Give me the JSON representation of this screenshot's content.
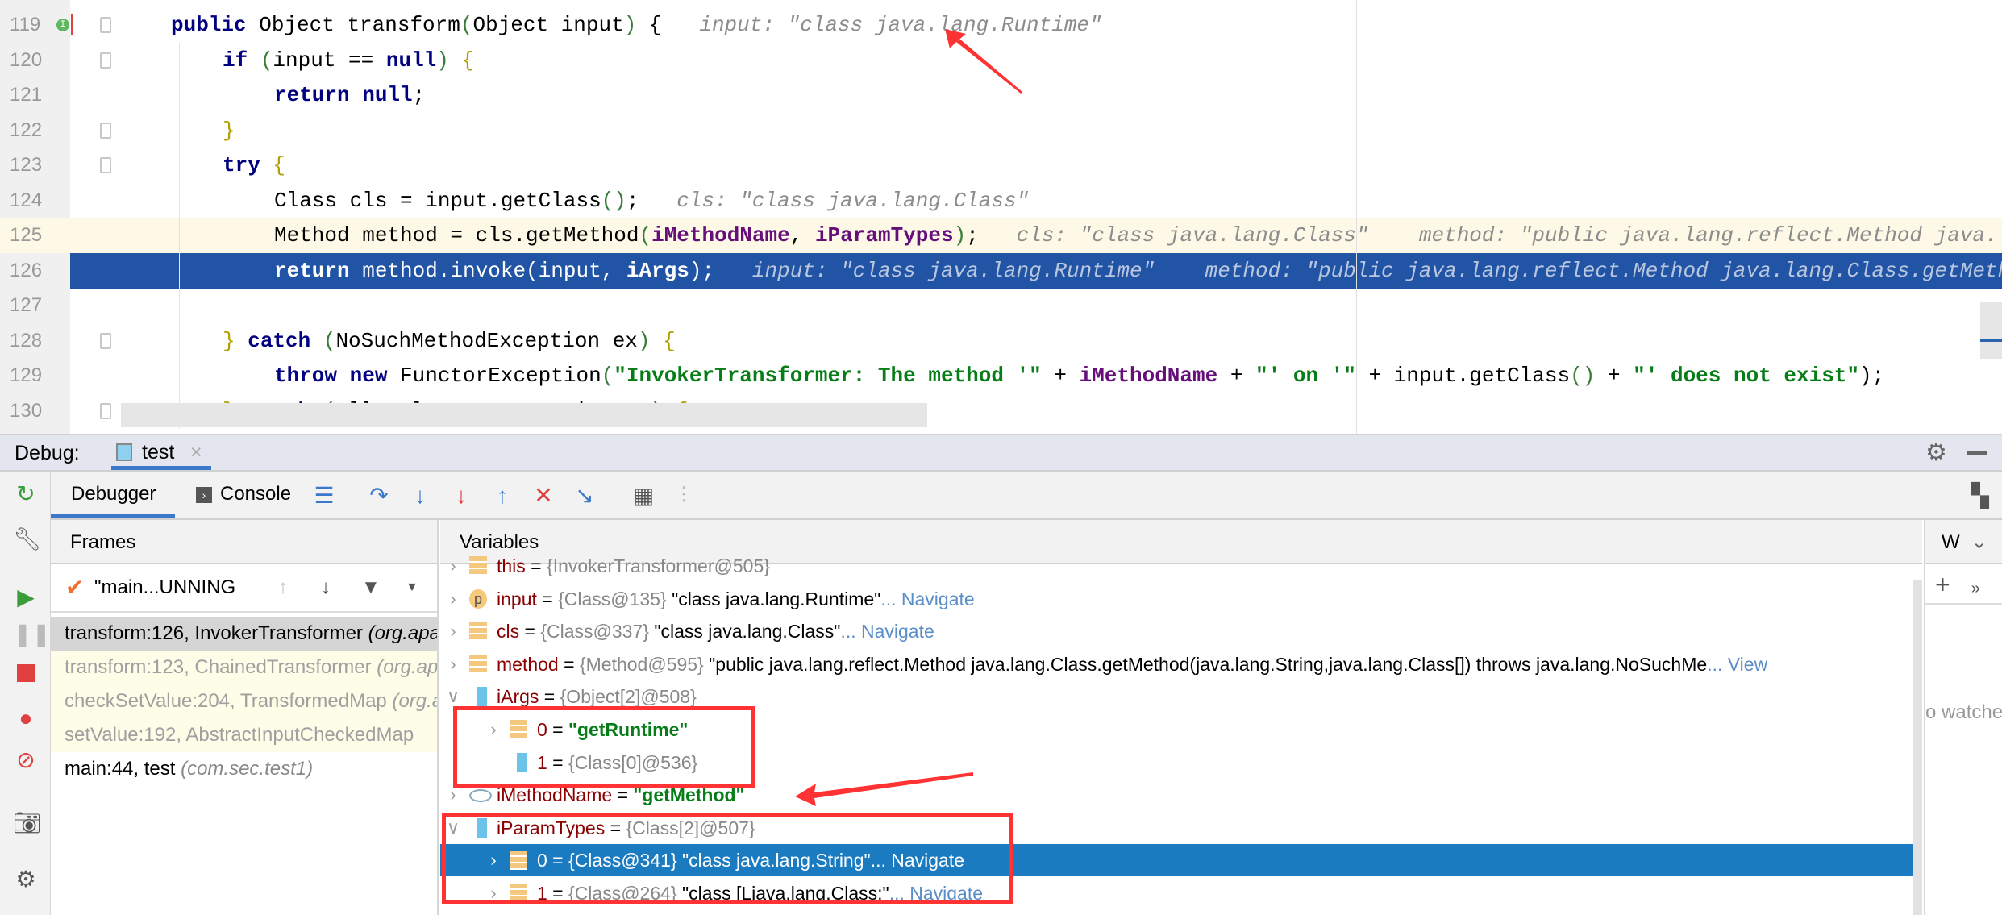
{
  "editor": {
    "lines": [
      {
        "num": "119",
        "indent": 0,
        "fold": true,
        "breakpoint": "I",
        "tokens": [
          [
            "public",
            "kw"
          ],
          [
            " Object transform",
            "pl"
          ],
          [
            "(",
            "par"
          ],
          [
            "Object input",
            "pl"
          ],
          [
            ")",
            "par"
          ],
          [
            " {",
            "pl"
          ],
          [
            "   input: \"class java.lang.Runtime\"",
            "hint"
          ]
        ]
      },
      {
        "num": "120",
        "indent": 1,
        "fold": true,
        "tokens": [
          [
            "if ",
            "kw"
          ],
          [
            "(",
            "par"
          ],
          [
            "input == ",
            "pl"
          ],
          [
            "null",
            "kw"
          ],
          [
            ")",
            "par"
          ],
          [
            " {",
            "brc"
          ]
        ]
      },
      {
        "num": "121",
        "indent": 2,
        "tokens": [
          [
            "return null",
            "kw"
          ],
          [
            ";",
            "pl"
          ]
        ]
      },
      {
        "num": "122",
        "indent": 1,
        "fold": true,
        "tokens": [
          [
            "}",
            "brc"
          ]
        ]
      },
      {
        "num": "123",
        "indent": 1,
        "fold": true,
        "tokens": [
          [
            "try ",
            "kw"
          ],
          [
            "{",
            "brc"
          ]
        ]
      },
      {
        "num": "124",
        "indent": 2,
        "tokens": [
          [
            "Class cls = input.getClass",
            "pl"
          ],
          [
            "()",
            "par"
          ],
          [
            ";",
            "pl"
          ],
          [
            "   cls: \"class java.lang.Class\"",
            "hint"
          ]
        ]
      },
      {
        "num": "125",
        "indent": 2,
        "state": "exec",
        "tokens": [
          [
            "Method method = cls.getMethod",
            "pl"
          ],
          [
            "(",
            "par"
          ],
          [
            "iMethodName",
            "fld"
          ],
          [
            ", ",
            "pl"
          ],
          [
            "iParamTypes",
            "fld"
          ],
          [
            ")",
            "par"
          ],
          [
            ";",
            "pl"
          ],
          [
            "   cls: \"class java.lang.Class\"    method: \"public java.lang.reflect.Method java.lang.Class.getMethod",
            "hint"
          ]
        ]
      },
      {
        "num": "126",
        "indent": 2,
        "state": "sel",
        "tokens": [
          [
            "return ",
            "kw"
          ],
          [
            "method.invoke(input, ",
            "pl"
          ],
          [
            "iArgs",
            "kw"
          ],
          [
            ");",
            "pl"
          ],
          [
            "   input: \"class java.lang.Runtime\"    method: \"public java.lang.reflect.Method java.lang.Class.getMethod",
            "hint"
          ]
        ]
      },
      {
        "num": "127",
        "indent": 2,
        "tokens": []
      },
      {
        "num": "128",
        "indent": 1,
        "fold": true,
        "tokens": [
          [
            "} ",
            "brc"
          ],
          [
            "catch ",
            "kw"
          ],
          [
            "(",
            "par"
          ],
          [
            "NoSuchMethodException ex",
            "pl"
          ],
          [
            ")",
            "par"
          ],
          [
            " {",
            "brc"
          ]
        ]
      },
      {
        "num": "129",
        "indent": 2,
        "tokens": [
          [
            "throw new ",
            "kw"
          ],
          [
            "FunctorException",
            "pl"
          ],
          [
            "(",
            "par"
          ],
          [
            "\"InvokerTransformer: The method '\"",
            "str"
          ],
          [
            " + ",
            "pl"
          ],
          [
            "iMethodName",
            "fld"
          ],
          [
            " + ",
            "pl"
          ],
          [
            "\"' on '\"",
            "str"
          ],
          [
            " + input.getClass",
            "pl"
          ],
          [
            "()",
            "par"
          ],
          [
            " + ",
            "pl"
          ],
          [
            "\"' does not exist\"",
            "str"
          ],
          [
            ");",
            "pl"
          ]
        ]
      },
      {
        "num": "130",
        "indent": 1,
        "fold": true,
        "tokens": [
          [
            "} ",
            "brc"
          ],
          [
            "catch ",
            "kw"
          ],
          [
            "(",
            "par"
          ],
          [
            "IllegalAccessException ex",
            "pl"
          ],
          [
            ")",
            "par"
          ],
          [
            " {",
            "brc"
          ]
        ]
      }
    ]
  },
  "debug": {
    "label": "Debug:",
    "session_tab": "test",
    "close_glyph": "×",
    "tabs": {
      "debugger": "Debugger",
      "console": "Console"
    },
    "frames_header": "Frames",
    "variables_header": "Variables",
    "watches_header": "W",
    "watches_empty": "o watche",
    "thread": "\"main...UNNING",
    "frames": [
      {
        "method": "transform:126, InvokerTransformer",
        "pkg": "(org.apache",
        "state": "selected"
      },
      {
        "method": "transform:123, ChainedTransformer",
        "pkg": "(org.apache",
        "state": "lib"
      },
      {
        "method": "checkSetValue:204, TransformedMap",
        "pkg": "(org.apache",
        "state": "lib"
      },
      {
        "method": "setValue:192, AbstractInputCheckedMap",
        "pkg": "",
        "state": "lib"
      },
      {
        "method": "main:44, test",
        "pkg": "(com.sec.test1)",
        "state": "normal"
      }
    ],
    "variables": [
      {
        "level": 0,
        "exp": "›",
        "icon": "field",
        "name": "this",
        "type": "{InvokerTransformer@505}",
        "value": "",
        "link": ""
      },
      {
        "level": 0,
        "exp": "›",
        "icon": "param",
        "name": "input",
        "type": "{Class@135}",
        "value": "\"class java.lang.Runtime\"",
        "link": "... Navigate"
      },
      {
        "level": 0,
        "exp": "›",
        "icon": "field",
        "name": "cls",
        "type": "{Class@337}",
        "value": "\"class java.lang.Class\"",
        "link": "... Navigate"
      },
      {
        "level": 0,
        "exp": "›",
        "icon": "field",
        "name": "method",
        "type": "{Method@595}",
        "value": "\"public java.lang.reflect.Method java.lang.Class.getMethod(java.lang.String,java.lang.Class[]) throws java.lang.NoSuchMe",
        "link": "... View"
      },
      {
        "level": 0,
        "exp": "∨",
        "icon": "array",
        "name": "iArgs",
        "type": "{Object[2]@508}",
        "value": "",
        "link": ""
      },
      {
        "level": 1,
        "exp": "›",
        "icon": "field",
        "name": "0",
        "type": "",
        "value": "\"getRuntime\"",
        "str": true,
        "link": ""
      },
      {
        "level": 1,
        "exp": "",
        "icon": "array",
        "name": "1",
        "type": "{Class[0]@536}",
        "value": "",
        "link": ""
      },
      {
        "level": 0,
        "exp": "›",
        "icon": "watch",
        "name": "iMethodName",
        "type": "",
        "value": "\"getMethod\"",
        "str": true,
        "link": ""
      },
      {
        "level": 0,
        "exp": "∨",
        "icon": "array",
        "name": "iParamTypes",
        "type": "{Class[2]@507}",
        "value": "",
        "link": ""
      },
      {
        "level": 1,
        "exp": "›",
        "icon": "field",
        "name": "0",
        "type": "{Class@341}",
        "value": "\"class java.lang.String\"",
        "link": "... Navigate",
        "selected": true
      },
      {
        "level": 1,
        "exp": "›",
        "icon": "field",
        "name": "1",
        "type": "{Class@264}",
        "value": "\"class [Ljava.lang.Class;\"",
        "link": "... Navigate"
      }
    ]
  },
  "colors": {
    "accent": "#2154a5",
    "selection": "#1a7bc1",
    "annotation": "#ff3333"
  }
}
